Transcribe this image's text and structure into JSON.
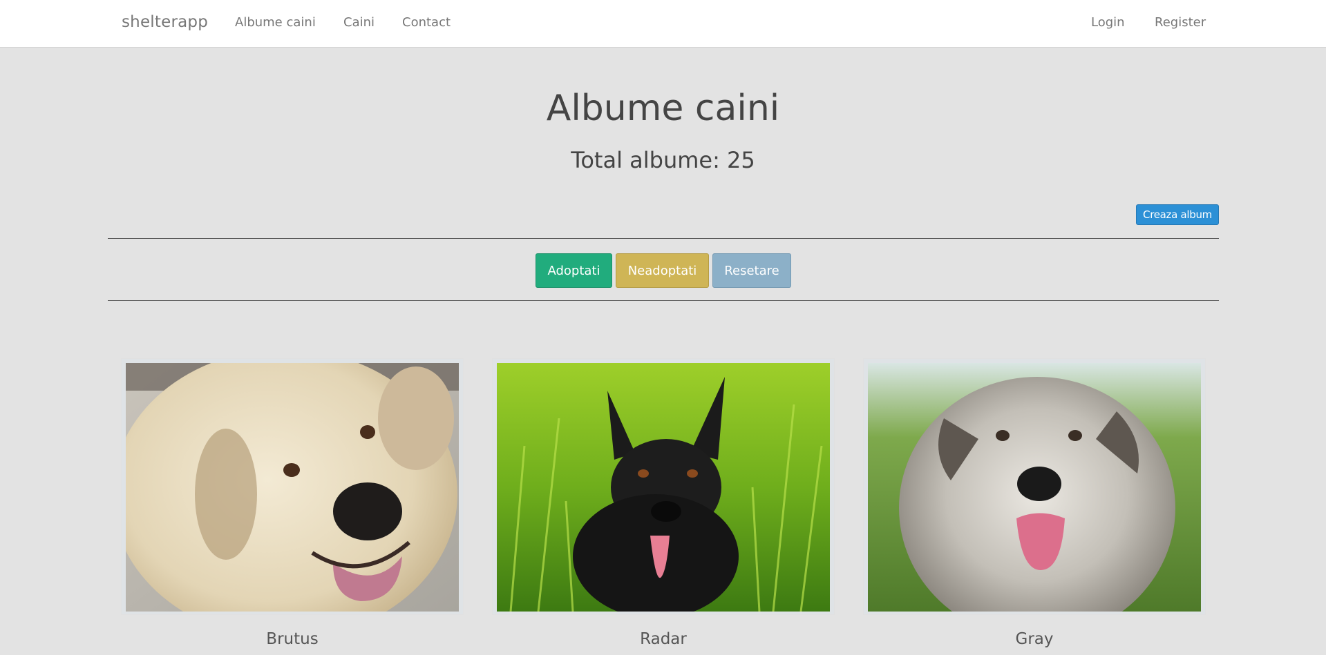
{
  "navbar": {
    "brand": "shelterapp",
    "links": [
      "Albume caini",
      "Caini",
      "Contact"
    ],
    "auth": [
      "Login",
      "Register"
    ]
  },
  "page": {
    "title": "Albume caini",
    "subtitle": "Total albume: 25",
    "create_button": "Creaza album"
  },
  "filters": {
    "adoptati": "Adoptati",
    "neadoptati": "Neadoptati",
    "resetare": "Resetare"
  },
  "albums": [
    {
      "name": "Brutus"
    },
    {
      "name": "Radar"
    },
    {
      "name": "Gray"
    }
  ],
  "colors": {
    "adoptati": "#21ac7d",
    "neadoptati": "#cfb556",
    "resetare": "#8cb0c8",
    "primary": "#2c90d6",
    "background": "#e3e3e3"
  }
}
